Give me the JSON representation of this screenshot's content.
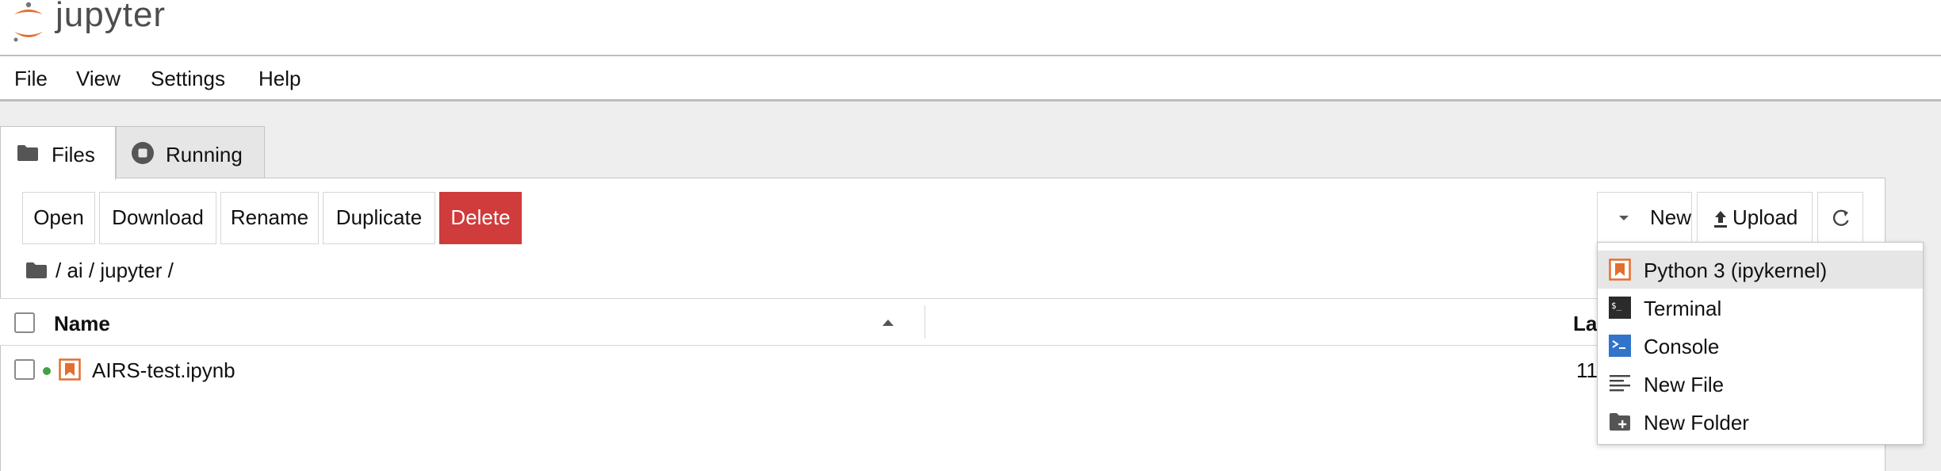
{
  "header": {
    "logo_text": "jupyter"
  },
  "menubar": {
    "items": [
      "File",
      "View",
      "Settings",
      "Help"
    ]
  },
  "tabs": [
    {
      "label": "Files",
      "icon": "folder-icon",
      "active": true
    },
    {
      "label": "Running",
      "icon": "stop-circle-icon",
      "active": false
    }
  ],
  "toolbar": {
    "open": "Open",
    "download": "Download",
    "rename": "Rename",
    "duplicate": "Duplicate",
    "delete": "Delete",
    "new": "New",
    "upload": "Upload",
    "refresh_icon": "refresh-icon"
  },
  "breadcrumb": {
    "path": "/ ai / jupyter /"
  },
  "table": {
    "columns": {
      "name": "Name",
      "last_modified": "La"
    },
    "rows": [
      {
        "name": "AIRS-test.ipynb",
        "modified": "11",
        "running": true
      }
    ]
  },
  "new_menu": {
    "items": [
      {
        "label": "Python 3 (ipykernel)",
        "icon": "notebook-icon",
        "active": true
      },
      {
        "label": "Terminal",
        "icon": "terminal-icon"
      },
      {
        "label": "Console",
        "icon": "console-icon"
      },
      {
        "label": "New File",
        "icon": "text-file-icon"
      },
      {
        "label": "New Folder",
        "icon": "new-folder-icon"
      }
    ]
  },
  "colors": {
    "delete_red": "#d03b3b",
    "jupyter_orange": "#e46e2e",
    "console_blue": "#3174c9",
    "running_green": "#45a045"
  }
}
